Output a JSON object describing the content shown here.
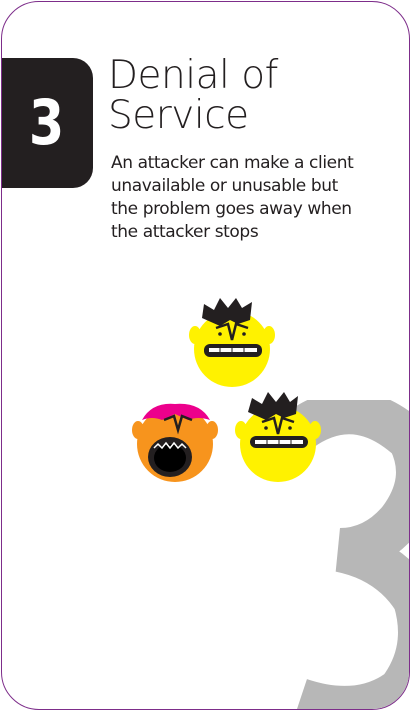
{
  "card": {
    "number": "3",
    "watermark_number": "3",
    "title_lines": [
      "Denial of",
      "Service"
    ],
    "description_lines": [
      "An attacker can make a client",
      "unavailable or unusable but",
      "the problem goes away when",
      "the attacker stops"
    ]
  },
  "colors": {
    "border": "#7d2d8a",
    "badge": "#231f20",
    "watermark": "#b7b7b7",
    "face_yellow": "#fff200",
    "face_orange": "#f7941d",
    "bandana": "#ec008c"
  },
  "illustration": {
    "icons": [
      "angry-yellow-face-icon",
      "angry-yellow-face-icon",
      "screaming-orange-face-icon"
    ]
  }
}
